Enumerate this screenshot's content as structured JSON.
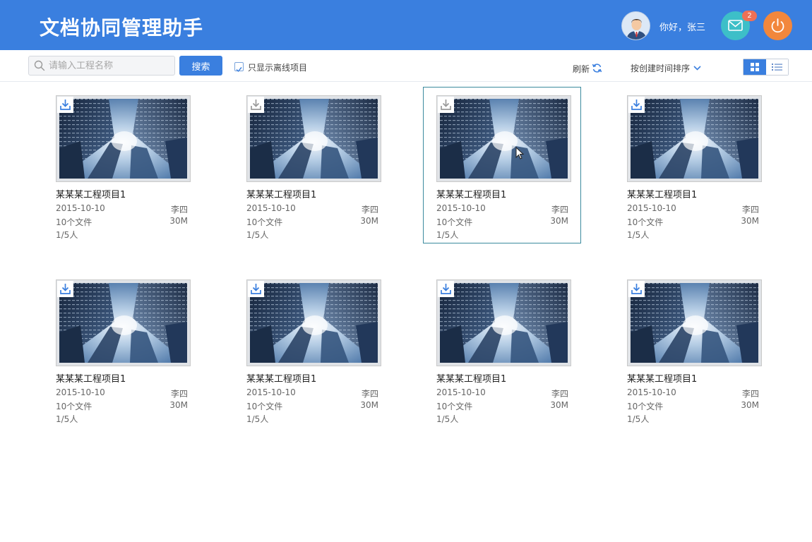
{
  "header": {
    "title": "文档协同管理助手",
    "greeting": "你好，张三",
    "mail_badge": "2",
    "icons": {
      "avatar": "user-avatar",
      "mail": "mail-icon",
      "power": "power-icon"
    },
    "colors": {
      "header_bg": "#3a7fdf",
      "mail_bg": "#3dbfc8",
      "power_bg": "#f2873c",
      "badge": "#f07055"
    }
  },
  "toolbar": {
    "search_placeholder": "请输入工程名称",
    "search_value": "",
    "search_button": "搜索",
    "offline_only_label": "只显示离线项目",
    "offline_only_checked": true,
    "refresh_label": "刷新",
    "sort_label": "按创建时间排序",
    "view_mode": "grid"
  },
  "projects": [
    {
      "name": "某某某工程项目1",
      "date": "2015-10-10",
      "owner": "李四",
      "files": "10个文件",
      "size": "30M",
      "members": "1/5人",
      "selected": false,
      "downloaded": true
    },
    {
      "name": "某某某工程项目1",
      "date": "2015-10-10",
      "owner": "李四",
      "files": "10个文件",
      "size": "30M",
      "members": "1/5人",
      "selected": false,
      "downloaded": false
    },
    {
      "name": "某某某工程项目1",
      "date": "2015-10-10",
      "owner": "李四",
      "files": "10个文件",
      "size": "30M",
      "members": "1/5人",
      "selected": true,
      "downloaded": false
    },
    {
      "name": "某某某工程项目1",
      "date": "2015-10-10",
      "owner": "李四",
      "files": "10个文件",
      "size": "30M",
      "members": "1/5人",
      "selected": false,
      "downloaded": true
    },
    {
      "name": "某某某工程项目1",
      "date": "2015-10-10",
      "owner": "李四",
      "files": "10个文件",
      "size": "30M",
      "members": "1/5人",
      "selected": false,
      "downloaded": true
    },
    {
      "name": "某某某工程项目1",
      "date": "2015-10-10",
      "owner": "李四",
      "files": "10个文件",
      "size": "30M",
      "members": "1/5人",
      "selected": false,
      "downloaded": true
    },
    {
      "name": "某某某工程项目1",
      "date": "2015-10-10",
      "owner": "李四",
      "files": "10个文件",
      "size": "30M",
      "members": "1/5人",
      "selected": false,
      "downloaded": true
    },
    {
      "name": "某某某工程项目1",
      "date": "2015-10-10",
      "owner": "李四",
      "files": "10个文件",
      "size": "30M",
      "members": "1/5人",
      "selected": false,
      "downloaded": true
    }
  ]
}
